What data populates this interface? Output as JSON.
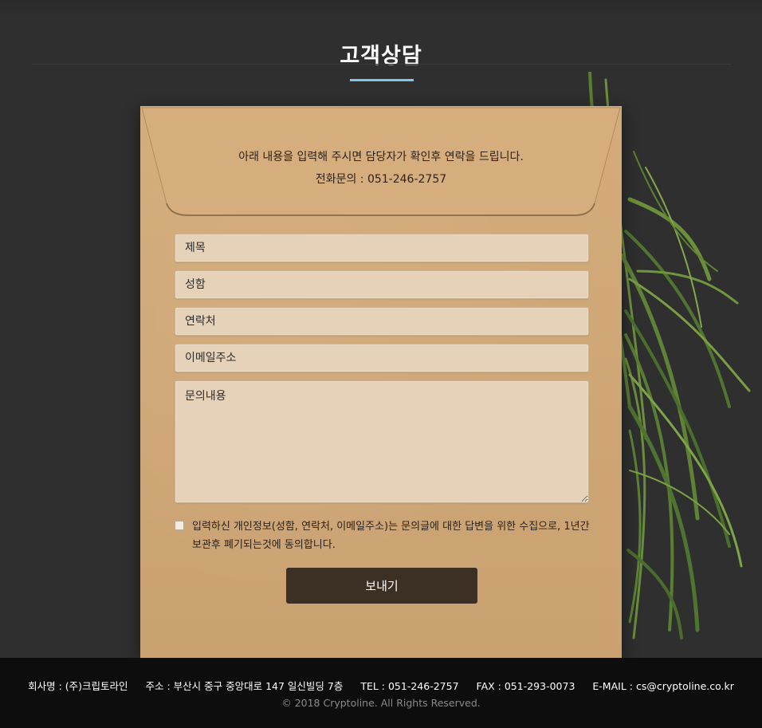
{
  "header": {
    "title": "고객상담"
  },
  "intro": {
    "line1": "아래 내용을 입력해 주시면 담당자가 확인후 연락을 드립니다.",
    "line2": "전화문의 : 051-246-2757"
  },
  "form": {
    "subject_placeholder": "제목",
    "name_placeholder": "성함",
    "phone_placeholder": "연락처",
    "email_placeholder": "이메일주소",
    "message_placeholder": "문의내용",
    "consent_text": "입력하신 개인정보(성함, 연락처, 이메일주소)는 문의글에 대한 답변을 위한 수집으로, 1년간 보관후 폐기되는것에 동의합니다.",
    "consent_checked": false,
    "submit_label": "보내기"
  },
  "footer": {
    "company": "회사명 : (주)크립토라인",
    "address": "주소 : 부산시 중구 중앙대로 147 일신빌딩 7층",
    "tel": "TEL : 051-246-2757",
    "fax": "FAX : 051-293-0073",
    "email": "E-MAIL : cs@cryptoline.co.kr",
    "copyright": "© 2018 Cryptoline. All Rights Reserved."
  },
  "colors": {
    "background": "#2f2f2f",
    "accent": "#7ec8e3",
    "envelope": "#cfa676",
    "button": "#3c2f24",
    "footer": "#0d0d0d"
  }
}
